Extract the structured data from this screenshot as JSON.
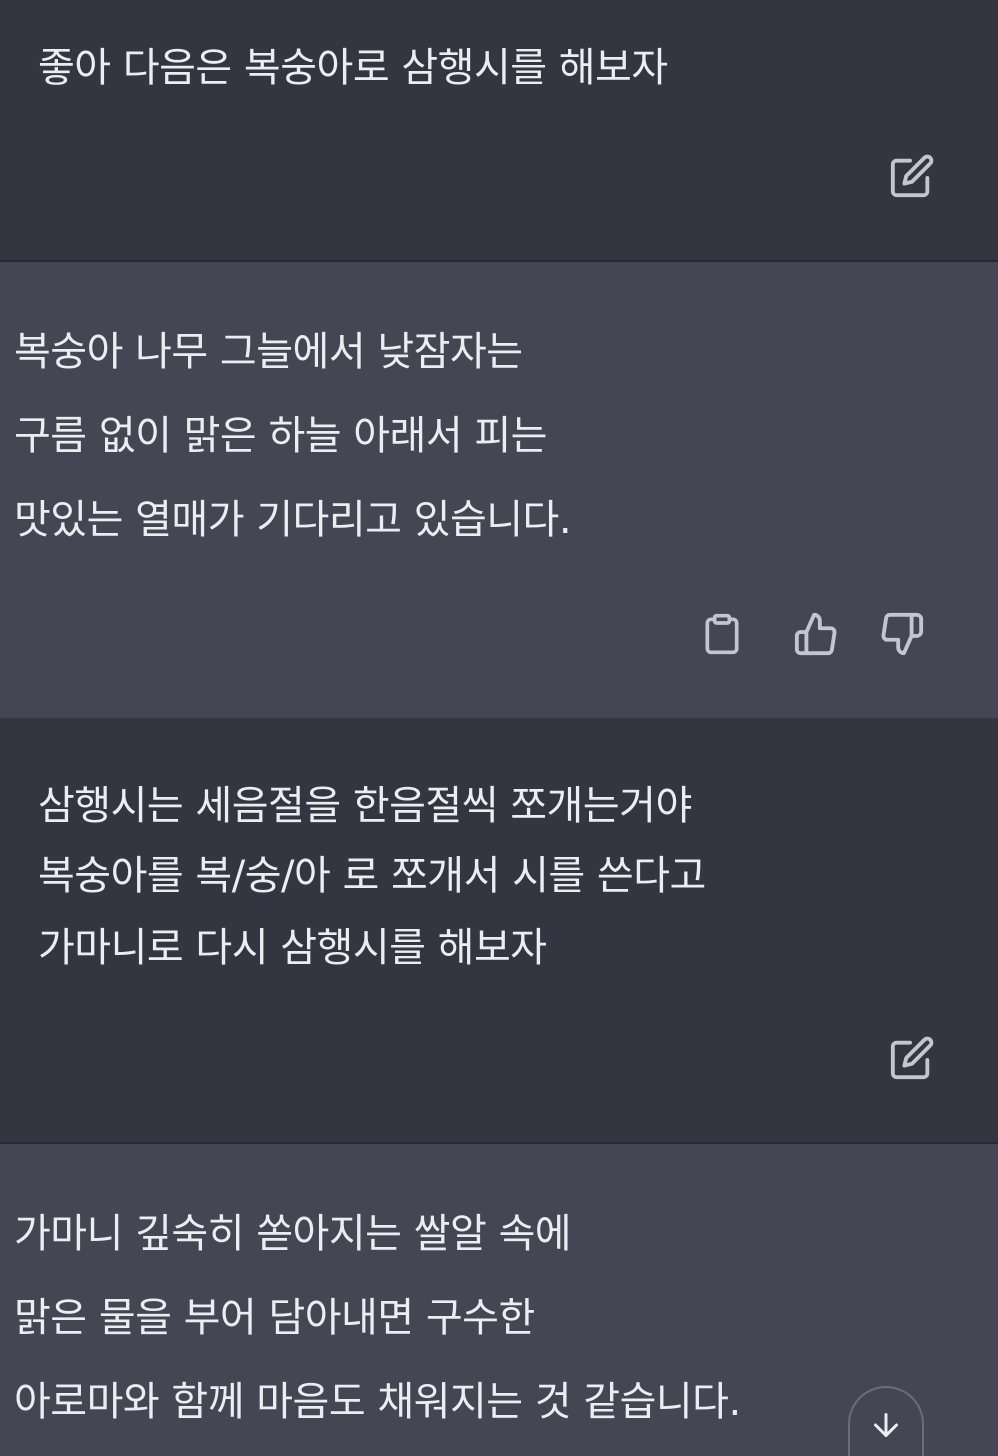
{
  "conversation": {
    "messages": [
      {
        "role": "user",
        "lines": [
          "좋아 다음은 복숭아로 삼행시를 해보자"
        ],
        "actions": {
          "edit_icon": "edit-icon"
        }
      },
      {
        "role": "assistant",
        "lines": [
          "복숭아 나무 그늘에서 낮잠자는",
          "구름 없이 맑은 하늘 아래서 피는",
          "맛있는 열매가 기다리고 있습니다."
        ],
        "actions": {
          "copy_icon": "clipboard-icon",
          "like_icon": "thumbs-up-icon",
          "dislike_icon": "thumbs-down-icon"
        }
      },
      {
        "role": "user",
        "lines": [
          "삼행시는 세음절을 한음절씩 쪼개는거야",
          "복숭아를 복/숭/아 로 쪼개서 시를 쓴다고",
          "가마니로 다시 삼행시를 해보자"
        ],
        "actions": {
          "edit_icon": "edit-icon"
        }
      },
      {
        "role": "assistant",
        "lines": [
          "가마니 깊숙히 쏟아지는 쌀알 속에",
          "맑은 물을 부어 담아내면 구수한",
          "아로마와 함께 마음도 채워지는 것 같습니다."
        ]
      }
    ]
  },
  "colors": {
    "user_bg": "#343541",
    "assistant_bg": "#444654",
    "text": "#ececf1",
    "icon": "#c5c5d2"
  },
  "scroll_button": {
    "icon": "arrow-down-icon"
  }
}
